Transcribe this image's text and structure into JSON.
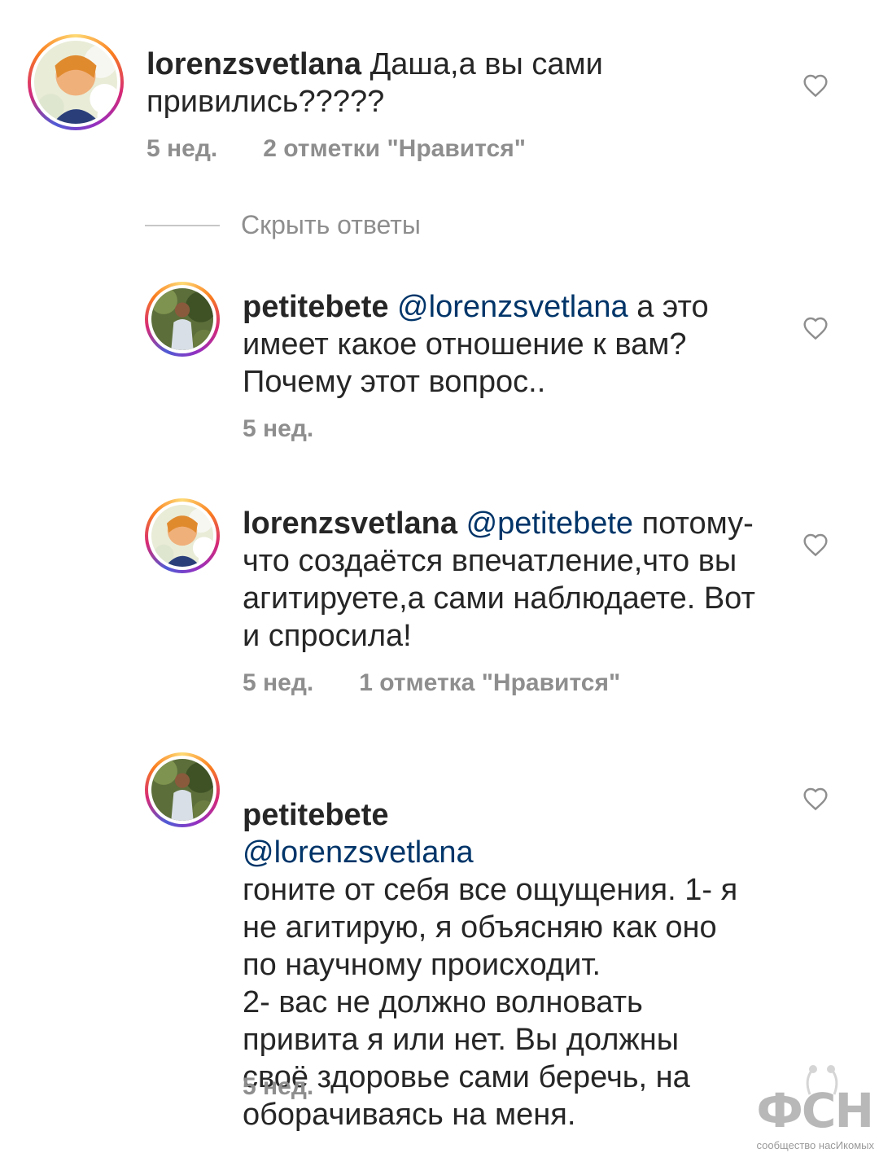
{
  "comments": [
    {
      "username": "lorenzsvetlana",
      "mention": "",
      "text": "Даша,а вы сами привились?????",
      "time": "5 нед.",
      "likes": "2 отметки \"Нравится\""
    },
    {
      "username": "petitebete",
      "mention": "@lorenzsvetlana",
      "text": "а это имеет какое отношение к вам? Почему этот вопрос..",
      "time": "5 нед.",
      "likes": ""
    },
    {
      "username": "lorenzsvetlana",
      "mention": "@petitebete",
      "text": "потому-что создаётся впечатление,что вы агитируете,а сами наблюдаете. Вот и спросила!",
      "time": "5 нед.",
      "likes": "1 отметка \"Нравится\""
    },
    {
      "username": "petitebete",
      "mention": "@lorenzsvetlana",
      "text": "гоните от себя все ощущения. 1- я не агитирую, я объясняю как оно по научному происходит.\n2- вас не должно волновать привита я или нет. Вы должны своё здоровье сами беречь, на оборачиваясь на меня.",
      "time": "5 нед.",
      "likes": ""
    }
  ],
  "hide_replies": "Скрыть ответы",
  "watermark": {
    "logo": "ФСН",
    "caption": "сообщество насИкомых"
  },
  "icons": {
    "like": "heart-outline-icon"
  }
}
